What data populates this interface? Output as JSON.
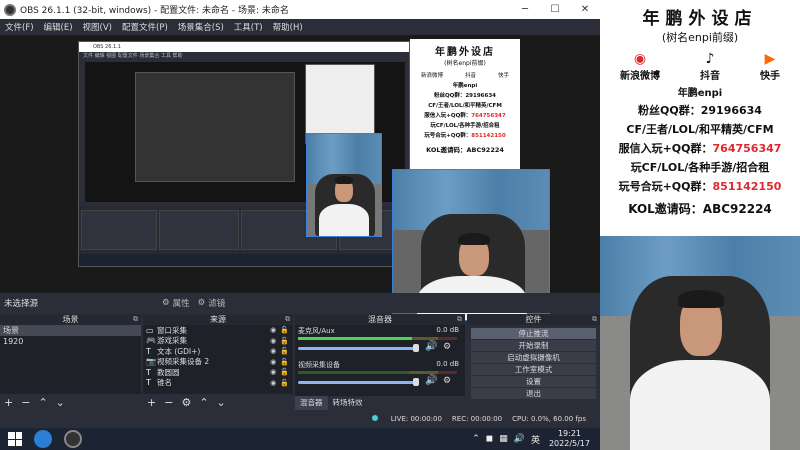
{
  "window": {
    "title": "OBS 26.1.1 (32-bit, windows) - 配置文件: 未命名 - 场景: 未命名"
  },
  "menu": [
    "文件(F)",
    "编辑(E)",
    "视图(V)",
    "配置文件(P)",
    "场景集合(S)",
    "工具(T)",
    "帮助(H)"
  ],
  "source_bar": {
    "no_source": "未选择源",
    "properties": "属性",
    "filters": "滤镜"
  },
  "scenes": {
    "title": "场景",
    "items": [
      "场景",
      "1920"
    ]
  },
  "sources": {
    "title": "来源",
    "items": [
      {
        "icon": "▭",
        "label": "窗口采集"
      },
      {
        "icon": "🎮",
        "label": "游戏采集"
      },
      {
        "icon": "T",
        "label": "文本 (GDI+)"
      },
      {
        "icon": "📷",
        "label": "视频采集设备 2"
      },
      {
        "icon": "T",
        "label": "教圆圆"
      },
      {
        "icon": "T",
        "label": "锥名"
      }
    ]
  },
  "mixer": {
    "title": "混音器",
    "channels": [
      {
        "name": "麦克风/Aux",
        "db": "0.0 dB",
        "level": 0.72
      },
      {
        "name": "视频采集设备",
        "db": "0.0 dB",
        "level": 0.0
      }
    ],
    "tabs": [
      "混音器",
      "转场特效"
    ]
  },
  "controls": {
    "title": "控件",
    "buttons": [
      "停止推流",
      "开始录制",
      "启动虚拟摄像机",
      "工作室模式",
      "设置",
      "退出"
    ]
  },
  "status": {
    "live": "LIVE: 00:00:00",
    "rec": "REC: 00:00:00",
    "cpu": "CPU: 0.0%, 60.00 fps"
  },
  "taskbar": {
    "time": "19:21",
    "date": "2022/5/17"
  },
  "shop": {
    "title": "年鹏外设店",
    "subtitle": "(树名enpi前缀)",
    "weibo": "新浪微博",
    "douyin": "抖音",
    "kuaishou": "快手",
    "host": "年鹏enpi",
    "fans_label": "粉丝QQ群：",
    "fans_number": "29196634",
    "games_line": "CF/王者/LOL/和平精英/CFM",
    "group_label": "服信入玩+QQ群：",
    "group_number": "764756347",
    "games_line2": "玩CF/LOL/各种手游/招合租",
    "group2_label": "玩号合玩+QQ群：",
    "group2_number": "851142150",
    "kol": "KOL邀请码：ABC92224"
  },
  "colors": {
    "accent": "#3d7fd6",
    "meter_green": "#49d64a",
    "promo_red": "#e0282e"
  }
}
